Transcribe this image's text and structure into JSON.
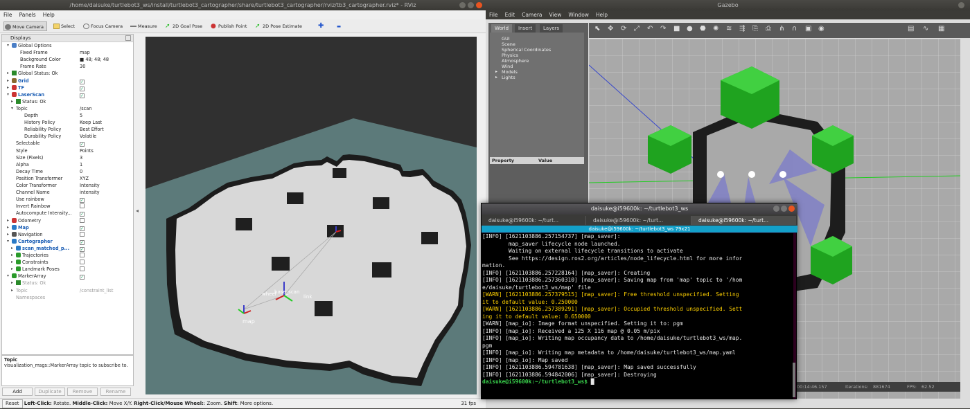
{
  "rviz": {
    "title": "/home/daisuke/turtlebot3_ws/install/turtlebot3_cartographer/share/turtlebot3_cartographer/rviz/tb3_cartographer.rviz* - RViz",
    "menu": [
      "File",
      "Panels",
      "Help"
    ],
    "tools": [
      "Move Camera",
      "Select",
      "Focus Camera",
      "Measure",
      "2D Goal Pose",
      "Publish Point",
      "2D Pose Estimate"
    ],
    "displays_title": "Displays",
    "rows": [
      {
        "label": "Global Options",
        "value": "",
        "indent": 1,
        "arrow": "▾",
        "icon": "globe"
      },
      {
        "label": "Fixed Frame",
        "value": "map",
        "indent": 3
      },
      {
        "label": "Background Color",
        "value": "■ 48; 48; 48",
        "indent": 3
      },
      {
        "label": "Frame Rate",
        "value": "30",
        "indent": 3
      },
      {
        "label": "Global Status: Ok",
        "value": "",
        "indent": 1,
        "arrow": "▸",
        "icon": "check"
      },
      {
        "label": "Grid",
        "value": "✓",
        "indent": 1,
        "arrow": "▸",
        "icon": "grid",
        "bold": true
      },
      {
        "label": "TF",
        "value": "✓",
        "indent": 1,
        "arrow": "▸",
        "icon": "tf",
        "bold": true
      },
      {
        "label": "LaserScan",
        "value": "✓",
        "indent": 1,
        "arrow": "▾",
        "icon": "laser",
        "bold": true
      },
      {
        "label": "Status: Ok",
        "value": "",
        "indent": 2,
        "arrow": "▸",
        "icon": "check"
      },
      {
        "label": "Topic",
        "value": "/scan",
        "indent": 2,
        "arrow": "▾"
      },
      {
        "label": "Depth",
        "value": "5",
        "indent": 4
      },
      {
        "label": "History Policy",
        "value": "Keep Last",
        "indent": 4
      },
      {
        "label": "Reliability Policy",
        "value": "Best Effort",
        "indent": 4
      },
      {
        "label": "Durability Policy",
        "value": "Volatile",
        "indent": 4
      },
      {
        "label": "Selectable",
        "value": "✓",
        "indent": 2
      },
      {
        "label": "Style",
        "value": "Points",
        "indent": 2
      },
      {
        "label": "Size (Pixels)",
        "value": "3",
        "indent": 2
      },
      {
        "label": "Alpha",
        "value": "1",
        "indent": 2
      },
      {
        "label": "Decay Time",
        "value": "0",
        "indent": 2
      },
      {
        "label": "Position Transformer",
        "value": "XYZ",
        "indent": 2
      },
      {
        "label": "Color Transformer",
        "value": "Intensity",
        "indent": 2
      },
      {
        "label": "Channel Name",
        "value": "intensity",
        "indent": 2
      },
      {
        "label": "Use rainbow",
        "value": "✓",
        "indent": 2
      },
      {
        "label": "Invert Rainbow",
        "value": "☐",
        "indent": 2
      },
      {
        "label": "Autocompute Intensity...",
        "value": "✓",
        "indent": 2
      },
      {
        "label": "Odometry",
        "value": "☐",
        "indent": 1,
        "arrow": "▸",
        "icon": "odom"
      },
      {
        "label": "Map",
        "value": "✓",
        "indent": 1,
        "arrow": "▸",
        "icon": "map",
        "bold": true
      },
      {
        "label": "Navigation",
        "value": "☐",
        "indent": 1,
        "arrow": "▸",
        "icon": "nav"
      },
      {
        "label": "Cartographer",
        "value": "✓",
        "indent": 1,
        "arrow": "▾",
        "icon": "folder",
        "bold": true
      },
      {
        "label": "scan_matched_p...",
        "value": "✓",
        "indent": 2,
        "arrow": "▸",
        "icon": "cloud",
        "bold": true
      },
      {
        "label": "Trajectories",
        "value": "☐",
        "indent": 2,
        "arrow": "▸",
        "icon": "marker"
      },
      {
        "label": "Constraints",
        "value": "☐",
        "indent": 2,
        "arrow": "▸",
        "icon": "marker"
      },
      {
        "label": "Landmark Poses",
        "value": "☐",
        "indent": 2,
        "arrow": "▸",
        "icon": "marker"
      },
      {
        "label": "MarkerArray",
        "value": "✓",
        "indent": 1,
        "arrow": "▾",
        "icon": "marker"
      },
      {
        "label": "Status: Ok",
        "value": "",
        "indent": 2,
        "arrow": "▸",
        "icon": "check",
        "grey": true
      },
      {
        "label": "Topic",
        "value": "/constraint_list",
        "indent": 2,
        "arrow": "▸",
        "grey": true
      },
      {
        "label": "Namespaces",
        "value": "",
        "indent": 2,
        "grey": true
      }
    ],
    "topic_title": "Topic",
    "topic_desc": "visualization_msgs::MarkerArray topic to subscribe to.",
    "buttons": [
      "Add",
      "Duplicate",
      "Remove",
      "Rename"
    ],
    "status": {
      "reset": "Reset",
      "b1": "Left-Click:",
      "t1": " Rotate. ",
      "b2": "Middle-Click:",
      "t2": " Move X/Y. ",
      "b3": "Right-Click/Mouse Wheel:",
      "t3": ": Zoom. ",
      "b4": "Shift",
      "t4": ": More options.",
      "fps": "31 fps"
    },
    "frame_labels": {
      "map": "map",
      "base": "base_scan",
      "wheel": "wheel",
      "link": "link"
    }
  },
  "gazebo": {
    "title": "Gazebo",
    "menu": [
      "File",
      "Edit",
      "Camera",
      "View",
      "Window",
      "Help"
    ],
    "tabs": [
      "World",
      "Insert",
      "Layers"
    ],
    "tree": [
      "GUI",
      "Scene",
      "Spherical Coordinates",
      "Physics",
      "Atmosphere",
      "Wind",
      "Models",
      "Lights"
    ],
    "prop_header": [
      "Property",
      "Value"
    ],
    "bottom": {
      "time": "00:14:46.157",
      "iter_label": "Iterations:",
      "iter": "881674",
      "fps_label": "FPS:",
      "fps": "62.52"
    }
  },
  "terminal": {
    "title": "daisuke@i59600k: ~/turtlebot3_ws",
    "tabs": [
      "daisuke@i59600k: ~/turt...",
      "daisuke@i59600k: ~/turt...",
      "daisuke@i59600k: ~/turt..."
    ],
    "subtitle": "daisuke@i59600k: ~/turtlebot3_ws 79x21",
    "lines": [
      {
        "t": "[INFO] [1621103886.257154737] [map_saver]:",
        "c": ""
      },
      {
        "t": "        map_saver lifecycle node launched.",
        "c": ""
      },
      {
        "t": "        Waiting on external lifecycle transitions to activate",
        "c": ""
      },
      {
        "t": "        See https://design.ros2.org/articles/node_lifecycle.html for more infor",
        "c": ""
      },
      {
        "t": "mation.",
        "c": ""
      },
      {
        "t": "[INFO] [1621103886.257228164] [map_saver]: Creating",
        "c": ""
      },
      {
        "t": "[INFO] [1621103886.257360310] [map_saver]: Saving map from 'map' topic to '/hom",
        "c": ""
      },
      {
        "t": "e/daisuke/turtlebot3_ws/map' file",
        "c": ""
      },
      {
        "t": "[WARN] [1621103886.257379515] [map_saver]: Free threshold unspecified. Setting",
        "c": "warn"
      },
      {
        "t": "it to default value: 0.250000",
        "c": "warn"
      },
      {
        "t": "[WARN] [1621103886.257389291] [map_saver]: Occupied threshold unspecified. Sett",
        "c": "warn"
      },
      {
        "t": "ing it to default value: 0.650000",
        "c": "warn"
      },
      {
        "t": "[WARN] [map_io]: Image format unspecified. Setting it to: pgm",
        "c": ""
      },
      {
        "t": "[INFO] [map_io]: Received a 125 X 116 map @ 0.05 m/pix",
        "c": ""
      },
      {
        "t": "[INFO] [map_io]: Writing map occupancy data to /home/daisuke/turtlebot3_ws/map.",
        "c": ""
      },
      {
        "t": "pgm",
        "c": ""
      },
      {
        "t": "[INFO] [map_io]: Writing map metadata to /home/daisuke/turtlebot3_ws/map.yaml",
        "c": ""
      },
      {
        "t": "[INFO] [map_io]: Map saved",
        "c": ""
      },
      {
        "t": "[INFO] [1621103886.594781638] [map_saver]: Map saved successfully",
        "c": ""
      },
      {
        "t": "[INFO] [1621103886.594842006] [map_saver]: Destroying",
        "c": ""
      }
    ],
    "prompt": "daisuke@i59600k:~/turtlebot3_ws$"
  }
}
